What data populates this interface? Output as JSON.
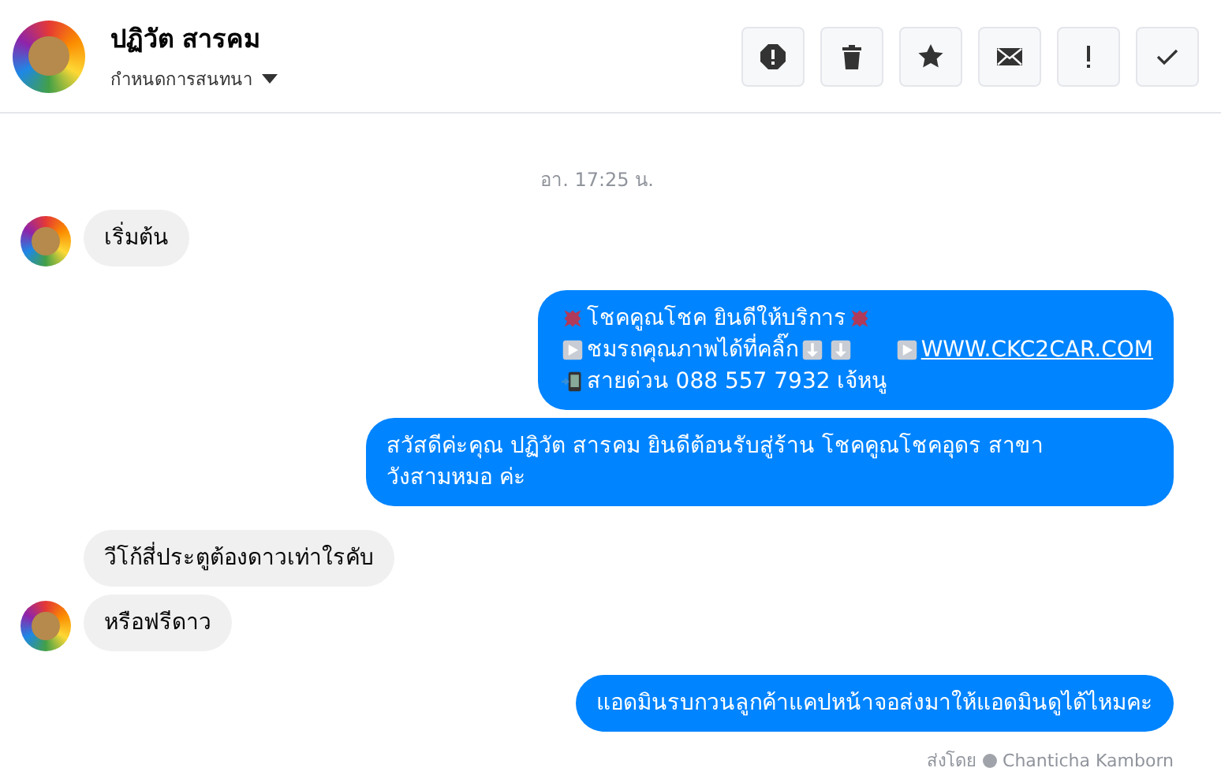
{
  "header": {
    "name": "ปฏิวัต สารคม",
    "subtitle": "กำหนดการสนทนา"
  },
  "actions": [
    {
      "kind": "alert"
    },
    {
      "kind": "trash"
    },
    {
      "kind": "star"
    },
    {
      "kind": "mail"
    },
    {
      "kind": "bang"
    },
    {
      "kind": "check"
    }
  ],
  "timestamp": "อา. 17:25 น.",
  "messages": [
    {
      "kind": "incoming",
      "avatar": true,
      "lines": [
        [
          {
            "kind": "text",
            "text": "เริ่มต้น"
          }
        ]
      ]
    },
    {
      "kind": "outgoing",
      "avatar": false,
      "lines": [
        [
          {
            "kind": "burst"
          },
          {
            "kind": "text",
            "text": "โชคคูณโชค ยินดีให้บริการ"
          },
          {
            "kind": "burst"
          }
        ],
        [
          {
            "kind": "play"
          },
          {
            "kind": "text",
            "text": "ชมรถคุณภาพได้ที่คลิ๊ก"
          },
          {
            "kind": "arrow"
          },
          {
            "kind": "arrow"
          },
          {
            "kind": "gap"
          },
          {
            "kind": "play"
          },
          {
            "kind": "link",
            "text": "WWW.CKC2CAR.COM"
          }
        ],
        [
          {
            "kind": "phone"
          },
          {
            "kind": "text",
            "text": "สายด่วน 088 557 7932 เจ้หนู"
          }
        ]
      ]
    },
    {
      "kind": "outgoing",
      "avatar": false,
      "lines": [
        [
          {
            "kind": "text",
            "text": "สวัสดีค่ะคุณ ปฏิวัต สารคม ยินดีต้อนรับสู่ร้าน โชคคูณโชคอุดร สาขา วังสามหมอ ค่ะ"
          }
        ]
      ]
    },
    {
      "kind": "incoming",
      "avatar": false,
      "lines": [
        [
          {
            "kind": "text",
            "text": "วีโก้สี่ประตูต้องดาวเท่าใรคับ"
          }
        ]
      ]
    },
    {
      "kind": "incoming",
      "avatar": true,
      "lines": [
        [
          {
            "kind": "text",
            "text": "หรือฟรีดาว"
          }
        ]
      ]
    },
    {
      "kind": "outgoing",
      "avatar": false,
      "lines": [
        [
          {
            "kind": "text",
            "text": "แอดมินรบกวนลูกค้าแคปหน้าจอส่งมาให้แอดมินดูได้ไหมคะ"
          }
        ]
      ]
    }
  ],
  "sent_by": {
    "label": "ส่งโดย",
    "name": "Chanticha Kamborn"
  }
}
